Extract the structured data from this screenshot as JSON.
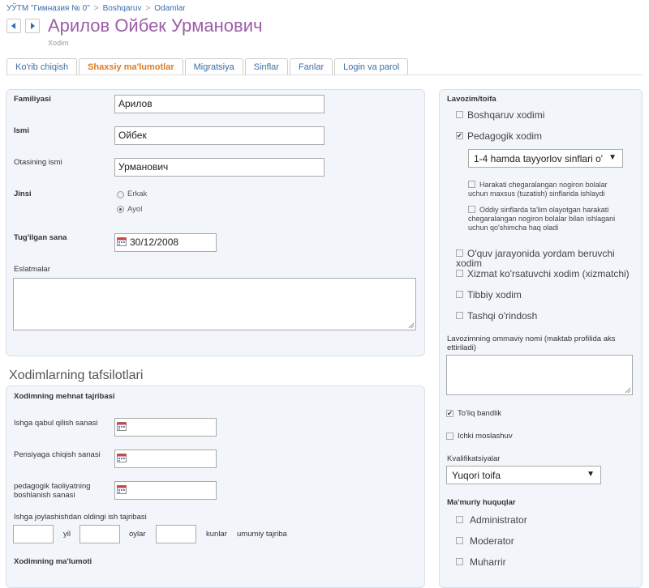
{
  "breadcrumb": {
    "root": "УЎТМ \"Гимназия № 0\"",
    "sep": ">",
    "level2": "Boshqaruv",
    "level3": "Odamlar"
  },
  "header": {
    "title": "Арилов Ойбек Урманович",
    "role": "Xodim"
  },
  "tabs": [
    "Ko'rib chiqish",
    "Shaxsiy ma'lumotlar",
    "Migratsiya",
    "Sinflar",
    "Fanlar",
    "Login va parol"
  ],
  "personal": {
    "familiya_label": "Familiyasi",
    "familiya_value": "Арилов",
    "ism_label": "Ismi",
    "ism_value": "Ойбек",
    "otasi_label": "Otasining ismi",
    "otasi_value": "Урманович",
    "jinsi_label": "Jinsi",
    "jinsi_options": [
      "Erkak",
      "Ayol"
    ],
    "jinsi_selected": "Ayol",
    "birth_label": "Tug'ilgan sana",
    "birth_value": "30/12/2008",
    "notes_label": "Eslatmalar"
  },
  "details": {
    "section_title": "Xodimlarning tafsilotlari",
    "mehnat_label": "Xodimning mehnat tajribasi",
    "ishga_label": "Ishga qabul qilish sanasi",
    "pensiya_label": "Pensiyaga chiqish sanasi",
    "pedagogik_label_1": "pedagogik faoliyatning",
    "pedagogik_label_2": "boshlanish sanasi",
    "oldingi_label": "Ishga joylashishdan oldingi ish tajribasi",
    "unit_yil": "yil",
    "unit_oylar": "oylar",
    "unit_kunlar": "kunlar",
    "unit_total": "umumiy tajriba",
    "malumot_label": "Xodimning ma'lumoti"
  },
  "lavozim": {
    "title": "Lavozim/toifa",
    "boshqaruv": "Boshqaruv xodimi",
    "pedagogik": "Pedagogik xodim",
    "pedagogik_select": "1-4 hamda tayyorlov sinflari o'",
    "harakati_1": "Harakati chegaralangan nogiron bolalar",
    "harakati_2": "uchun maxsus (tuzatish) sinflarida ishlaydi",
    "oddiy_1": "Oddiy sinflarda ta'lim olayotgan harakati",
    "oddiy_2": "chegaralangan nogiron bolalar bilan ishlagani",
    "oddiy_3": "uchun qo'shimcha haq oladi",
    "oquv_1": "O'quv jarayonida yordam beruvchi",
    "oquv_2": "xodim",
    "xizmat": "Xizmat ko'rsatuvchi xodim (xizmatchi)",
    "tibbiy": "Tibbiy xodim",
    "tashqi": "Tashqi o'rindosh",
    "ommaviy_1": "Lavozimning ommaviy nomi (maktab profilida aks",
    "ommaviy_2": "ettiriladi)",
    "toliq": "To'liq bandlik",
    "ichki": "Ichki moslashuv",
    "kval_label": "Kvalifikatsiyalar",
    "kval_value": "Yuqori toifa",
    "mamuriy": "Ma'muriy huquqlar",
    "admin": "Administrator",
    "moderator": "Moderator",
    "muharrir": "Muharrir"
  },
  "checks": {
    "pedagogik": "✔",
    "toliq": "✔"
  },
  "colors": {
    "title": "#9b5ea8",
    "tab_active": "#e07b22",
    "link": "#3a6fa8",
    "panel_bg": "#f2f6fb"
  }
}
